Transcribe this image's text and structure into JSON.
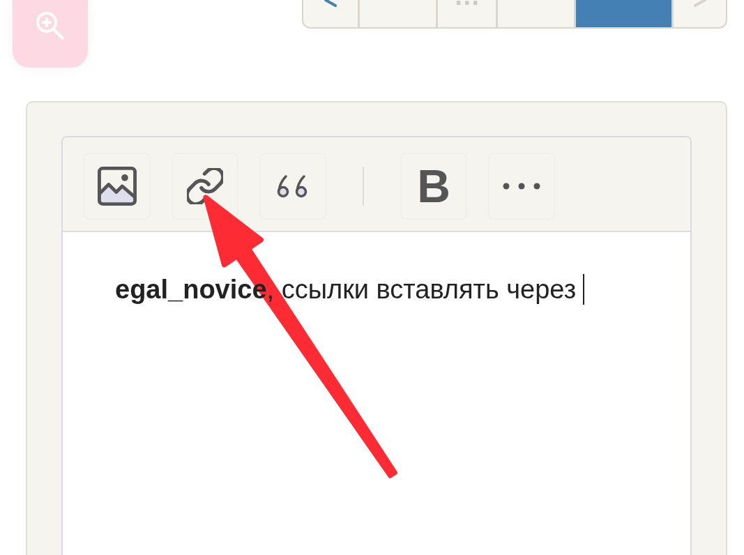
{
  "pagination": {
    "items": [
      {
        "kind": "prev",
        "disabled": false
      },
      {
        "kind": "page",
        "selected": false
      },
      {
        "kind": "gap",
        "label": "…"
      },
      {
        "kind": "page",
        "selected": false
      },
      {
        "kind": "page",
        "selected": true
      },
      {
        "kind": "next",
        "disabled": true
      }
    ]
  },
  "editor": {
    "toolbar": [
      {
        "kind": "image"
      },
      {
        "kind": "link"
      },
      {
        "kind": "quote"
      },
      {
        "kind": "separator"
      },
      {
        "kind": "bold",
        "label": "B"
      },
      {
        "kind": "more"
      }
    ],
    "content": {
      "text": "**egal_novice**, ссылки вставлять через",
      "cursor": true
    }
  }
}
